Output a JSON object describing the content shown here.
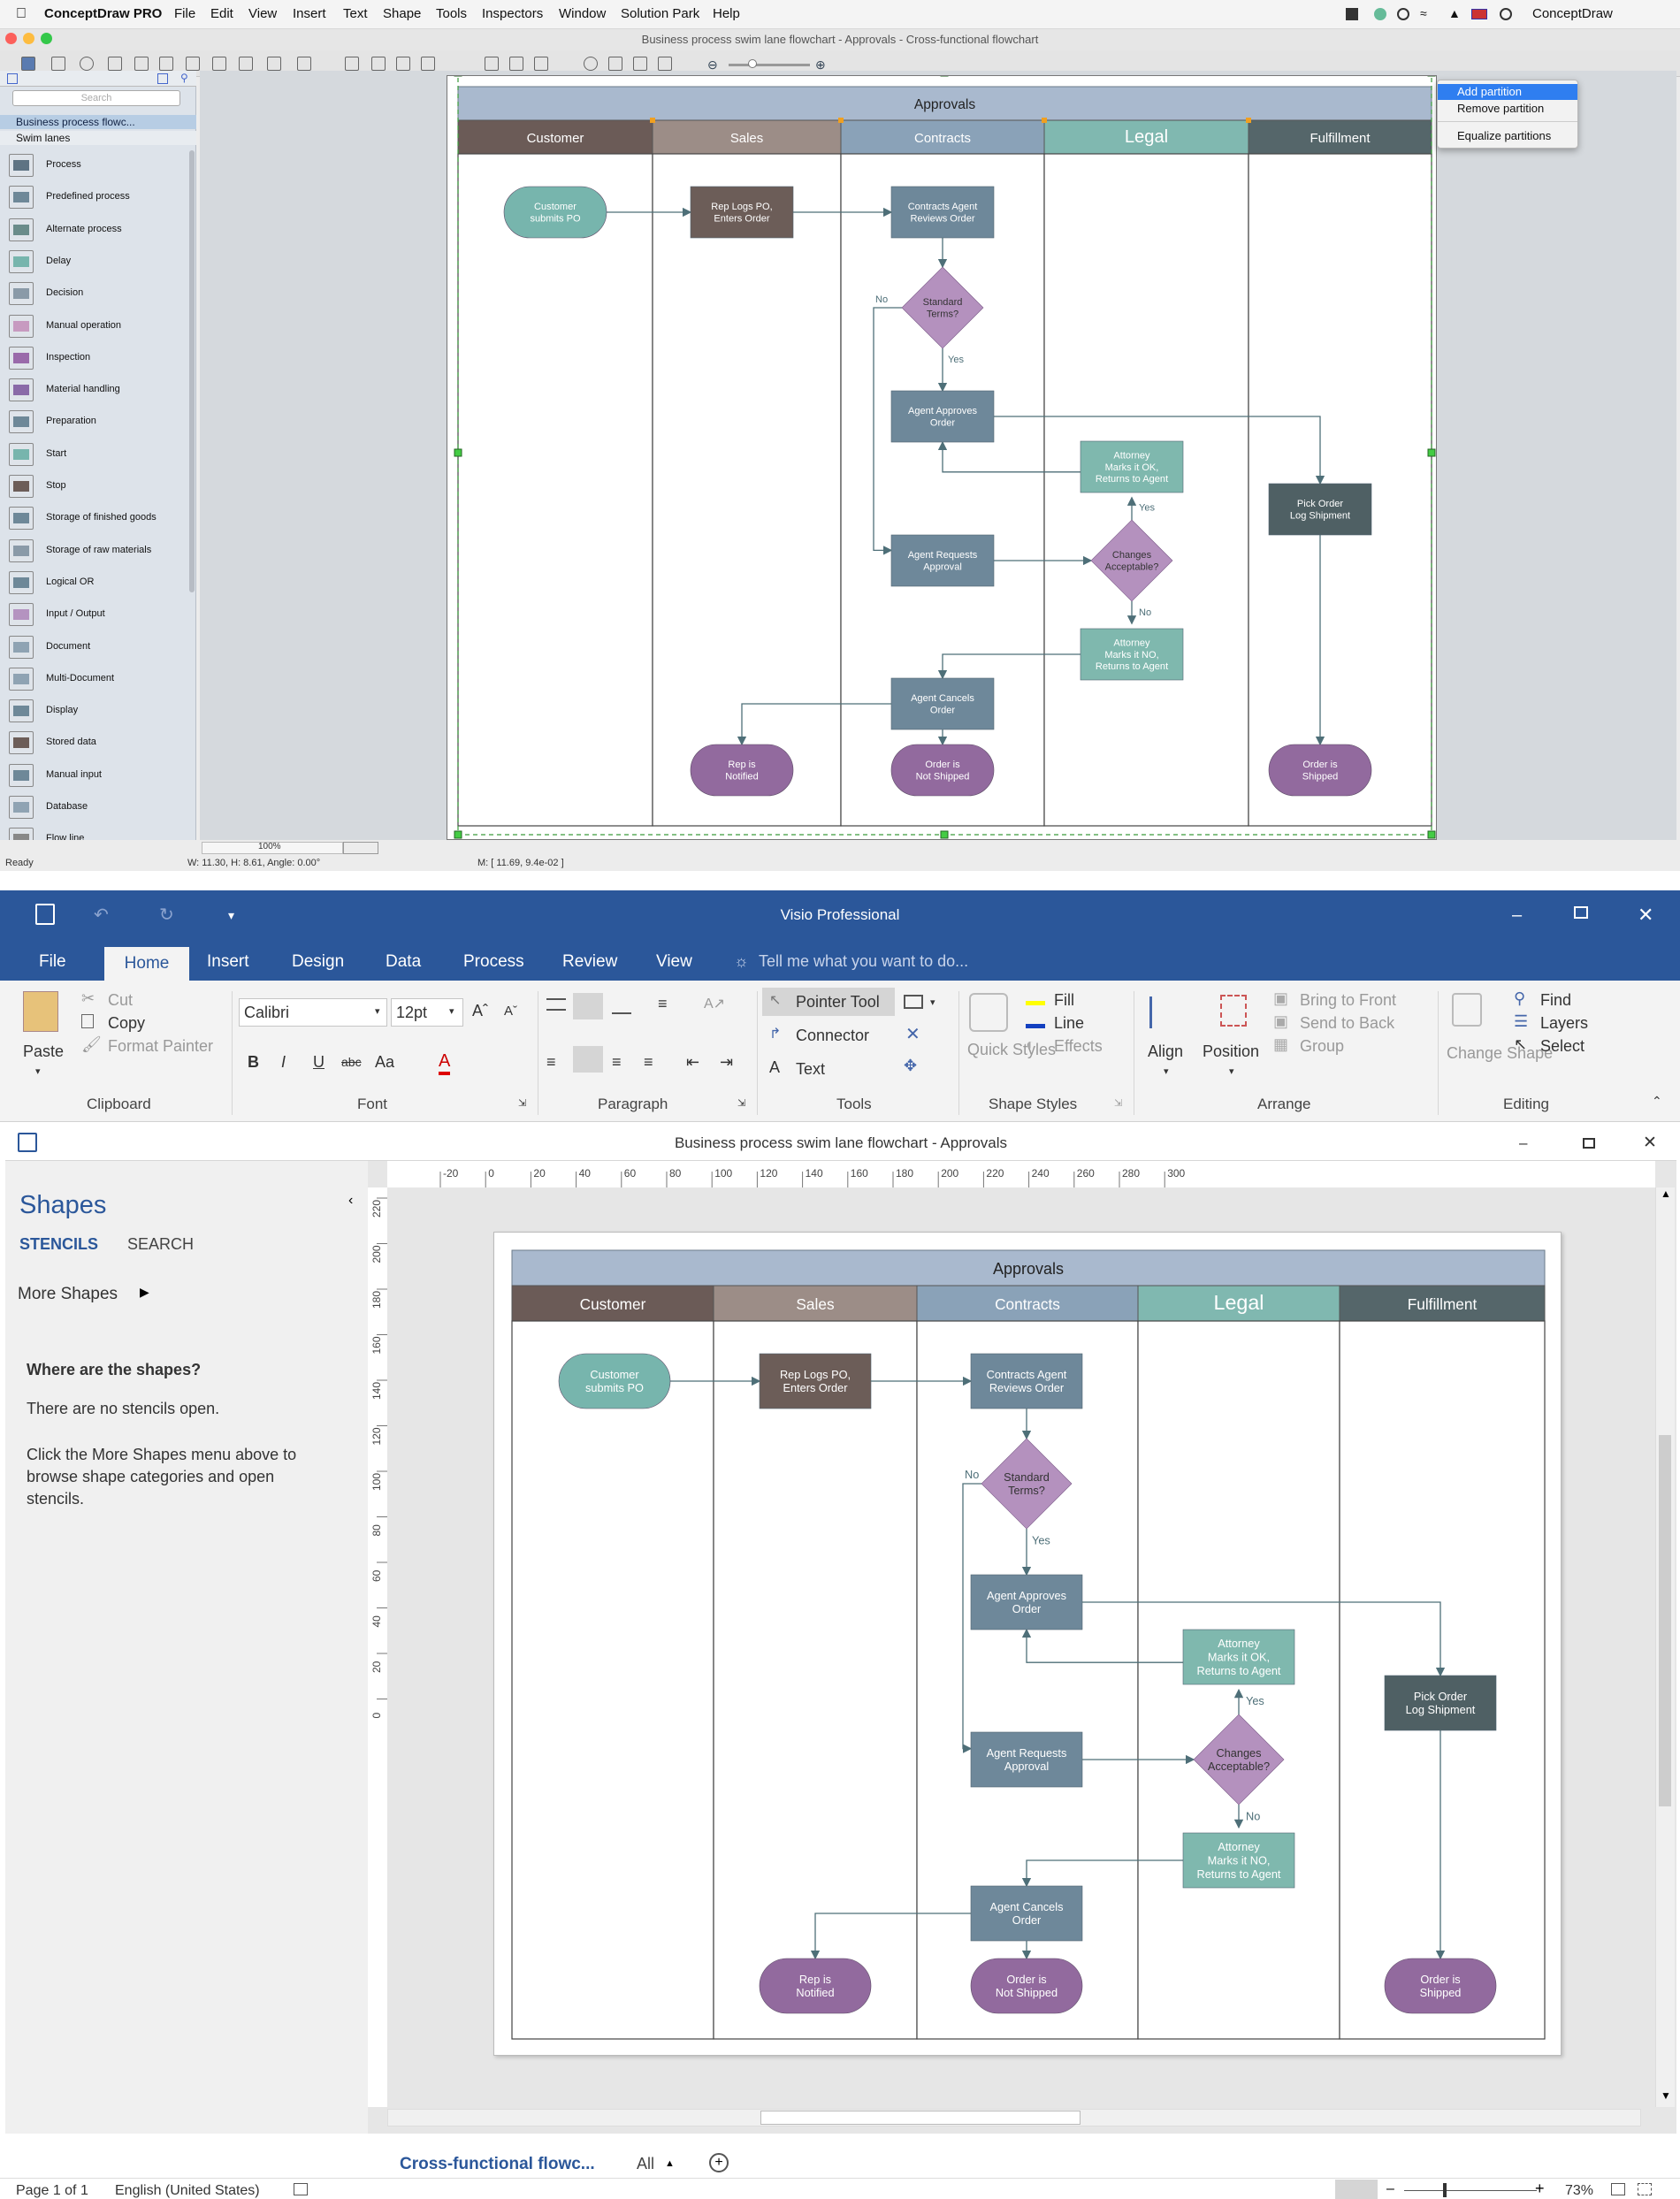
{
  "conceptdraw": {
    "app_name": "ConceptDraw PRO",
    "menu": [
      "File",
      "Edit",
      "View",
      "Insert",
      "Text",
      "Shape",
      "Tools",
      "Inspectors",
      "Window",
      "Solution Park",
      "Help"
    ],
    "menu_right": "ConceptDraw",
    "window_title": "Business process swim lane flowchart - Approvals - Cross-functional flowchart",
    "search_placeholder": "Search",
    "libraries": [
      "Business process flowc...",
      "Swim lanes"
    ],
    "shapes": [
      "Process",
      "Predefined process",
      "Alternate process",
      "Delay",
      "Decision",
      "Manual operation",
      "Inspection",
      "Material handling",
      "Preparation",
      "Start",
      "Stop",
      "Storage of finished goods",
      "Storage of raw materials",
      "Logical OR",
      "Input / Output",
      "Document",
      "Multi-Document",
      "Display",
      "Stored data",
      "Manual input",
      "Database",
      "Flow line"
    ],
    "context_menu": [
      "Add partition",
      "Remove partition",
      "Equalize partitions"
    ],
    "zoom": "100%",
    "status_ready": "Ready",
    "status_dims": "W: 11.30,  H: 8.61,  Angle: 0.00°",
    "status_mouse": "M: [ 11.69, 9.4e-02 ]"
  },
  "visio": {
    "app_title": "Visio Professional",
    "tabs": [
      "File",
      "Home",
      "Insert",
      "Design",
      "Data",
      "Process",
      "Review",
      "View"
    ],
    "tell_me": "Tell me what you want to do...",
    "ribbon": {
      "paste": "Paste",
      "cut": "Cut",
      "copy": "Copy",
      "format_painter": "Format Painter",
      "font_name": "Calibri",
      "font_size": "12pt",
      "pointer_tool": "Pointer Tool",
      "connector": "Connector",
      "text": "Text",
      "quick_styles": "Quick Styles",
      "fill": "Fill",
      "line": "Line",
      "effects": "Effects",
      "align": "Align",
      "position": "Position",
      "bring_to_front": "Bring to Front",
      "send_to_back": "Send to Back",
      "group": "Group",
      "change_shape": "Change Shape",
      "find": "Find",
      "layers": "Layers",
      "select": "Select",
      "groups": [
        "Clipboard",
        "Font",
        "Paragraph",
        "Tools",
        "Shape Styles",
        "Arrange",
        "Editing"
      ]
    },
    "doc_title": "Business process swim lane flowchart - Approvals",
    "shapes_panel": {
      "title": "Shapes",
      "stencils": "STENCILS",
      "search": "SEARCH",
      "more_shapes": "More Shapes",
      "heading": "Where are the shapes?",
      "p1": "There are no stencils open.",
      "p2": "Click the More Shapes menu above to browse shape categories and open stencils."
    },
    "ruler_h": [
      "-20",
      "0",
      "20",
      "40",
      "60",
      "80",
      "100",
      "120",
      "140",
      "160",
      "180",
      "200",
      "220",
      "240",
      "260",
      "280",
      "300"
    ],
    "ruler_v": [
      "220",
      "200",
      "180",
      "160",
      "140",
      "120",
      "100",
      "80",
      "60",
      "40",
      "20",
      "0"
    ],
    "page_tab": "Cross-functional flowc...",
    "all_tab": "All",
    "status_page": "Page 1 of 1",
    "status_lang": "English (United States)",
    "zoom": "73%"
  },
  "flowchart": {
    "title": "Approvals",
    "lanes": [
      "Customer",
      "Sales",
      "Contracts",
      "Legal",
      "Fulfillment"
    ],
    "nodes": {
      "customer_po": [
        "Customer",
        "submits PO"
      ],
      "rep_logs": [
        "Rep Logs PO,",
        "Enters Order"
      ],
      "agent_reviews": [
        "Contracts Agent",
        "Reviews Order"
      ],
      "standard_terms": [
        "Standard",
        "Terms?"
      ],
      "agent_approves": [
        "Agent Approves",
        "Order"
      ],
      "attorney_ok": [
        "Attorney",
        "Marks it OK,",
        "Returns to Agent"
      ],
      "pick_order": [
        "Pick Order",
        "Log Shipment"
      ],
      "agent_requests": [
        "Agent Requests",
        "Approval"
      ],
      "changes_acceptable": [
        "Changes",
        "Acceptable?"
      ],
      "attorney_no": [
        "Attorney",
        "Marks it NO,",
        "Returns to Agent"
      ],
      "agent_cancels": [
        "Agent Cancels",
        "Order"
      ],
      "rep_notified": [
        "Rep is",
        "Notified"
      ],
      "not_shipped": [
        "Order is",
        "Not Shipped"
      ],
      "shipped": [
        "Order is",
        "Shipped"
      ]
    },
    "labels": {
      "no": "No",
      "yes": "Yes"
    },
    "colors": {
      "title_bar": "#a9b9ce",
      "customer": "#6b5b57",
      "sales": "#9c8d87",
      "contracts": "#8aa2b8",
      "legal": "#80b8b0",
      "fulfillment": "#55666a",
      "process_dark": "#6c5d58",
      "process_blue": "#6e889a",
      "teal": "#7fb8ae",
      "teal_start": "#77b5ad",
      "purple": "#b491be",
      "purple_end": "#926a9e",
      "pick_order": "#4f6064"
    }
  }
}
